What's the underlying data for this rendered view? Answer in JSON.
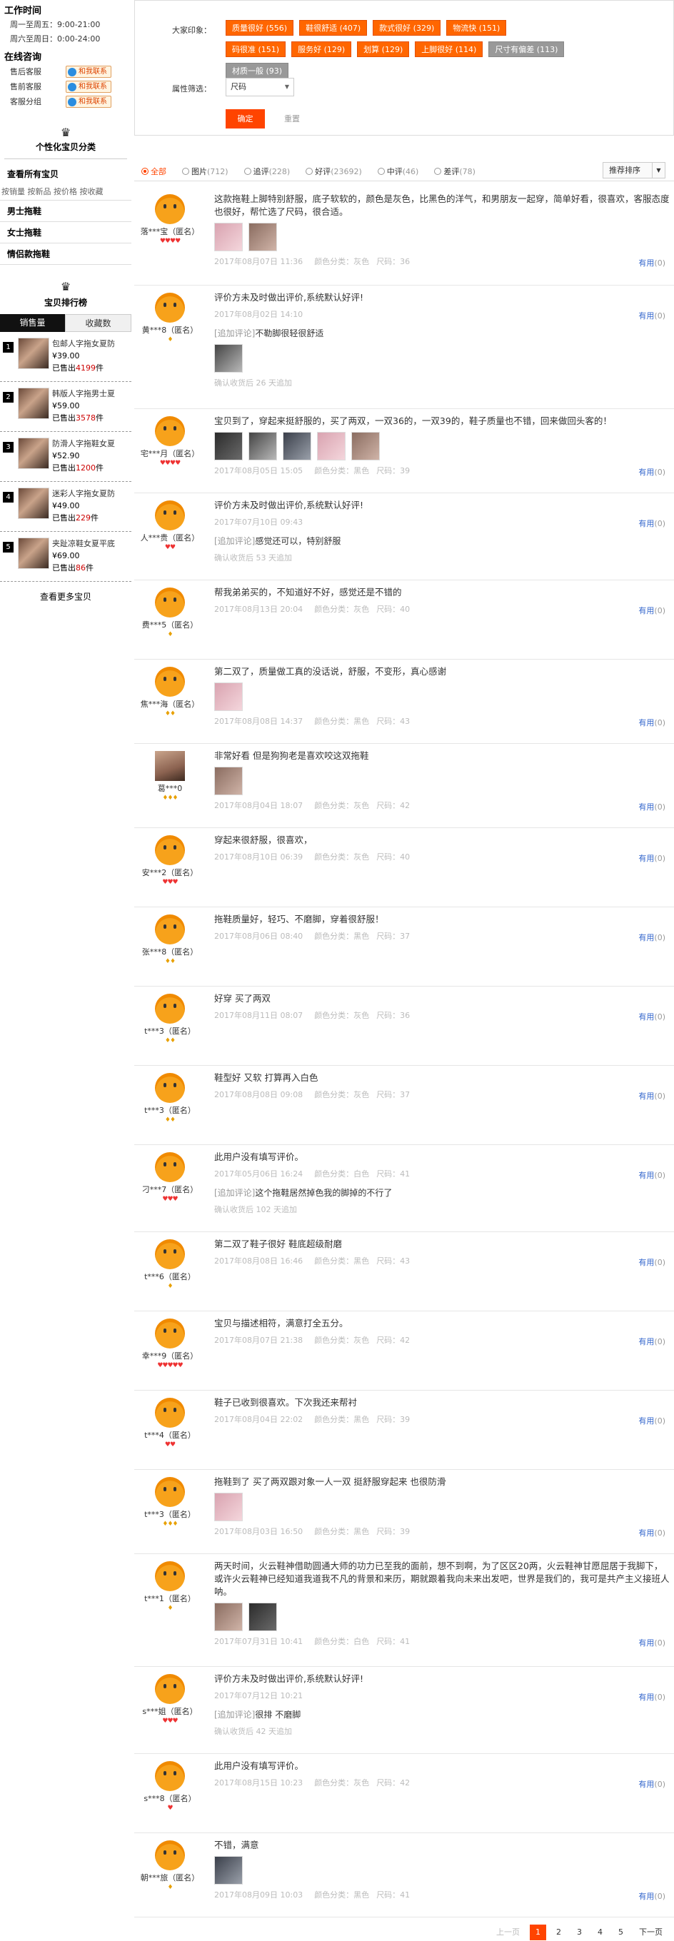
{
  "sidebar": {
    "hours_title": "工作时间",
    "hours": [
      "周一至周五：9:00-21:00",
      "周六至周日：0:00-24:00"
    ],
    "cs_title": "在线咨询",
    "cs": [
      {
        "label": "售后客服",
        "button": "和我联系"
      },
      {
        "label": "售前客服",
        "button": "和我联系"
      },
      {
        "label": "客服分组",
        "button": "和我联系"
      }
    ],
    "crown_icon": "crown-icon",
    "cat_title": "个性化宝贝分类",
    "all_goods": "查看所有宝贝",
    "sort_links": "按销量 按新品 按价格 按收藏",
    "categories": [
      "男士拖鞋",
      "女士拖鞋",
      "情侣款拖鞋"
    ],
    "rank_title": "宝贝排行榜",
    "rank_tabs": [
      "销售量",
      "收藏数"
    ],
    "rank_items": [
      {
        "num": "1",
        "name": "包邮人字拖女夏防",
        "price": "¥39.00",
        "sold_prefix": "已售出",
        "sold": "4199",
        "sold_suffix": "件"
      },
      {
        "num": "2",
        "name": "韩版人字拖男士夏",
        "price": "¥59.00",
        "sold_prefix": "已售出",
        "sold": "3578",
        "sold_suffix": "件"
      },
      {
        "num": "3",
        "name": "防滑人字拖鞋女夏",
        "price": "¥52.90",
        "sold_prefix": "已售出",
        "sold": "1200",
        "sold_suffix": "件"
      },
      {
        "num": "4",
        "name": "迷彩人字拖女夏防",
        "price": "¥49.00",
        "sold_prefix": "已售出",
        "sold": "229",
        "sold_suffix": "件"
      },
      {
        "num": "5",
        "name": "夹趾凉鞋女夏平底",
        "price": "¥69.00",
        "sold_prefix": "已售出",
        "sold": "86",
        "sold_suffix": "件"
      }
    ],
    "more": "查看更多宝贝"
  },
  "filter": {
    "impression_label": "大家印象：",
    "tags": [
      {
        "text": "质量很好 (556)",
        "neg": false
      },
      {
        "text": "鞋很舒适 (407)",
        "neg": false
      },
      {
        "text": "款式很好 (329)",
        "neg": false
      },
      {
        "text": "物流快 (151)",
        "neg": false
      },
      {
        "text": "码很准 (151)",
        "neg": false
      },
      {
        "text": "服务好 (129)",
        "neg": false
      },
      {
        "text": "划算 (129)",
        "neg": false
      },
      {
        "text": "上脚很好 (114)",
        "neg": false
      },
      {
        "text": "尺寸有偏差 (113)",
        "neg": true
      },
      {
        "text": "材质一般 (93)",
        "neg": true
      }
    ],
    "attr_label": "属性筛选：",
    "attr_value": "尺码",
    "confirm": "确定",
    "reset": "重置"
  },
  "typebar": {
    "options": [
      {
        "label": "全部",
        "count": "",
        "on": true
      },
      {
        "label": "图片",
        "count": "(712)",
        "on": false
      },
      {
        "label": "追评",
        "count": "(228)",
        "on": false
      },
      {
        "label": "好评",
        "count": "(23692)",
        "on": false
      },
      {
        "label": "中评",
        "count": "(46)",
        "on": false
      },
      {
        "label": "差评",
        "count": "(78)",
        "on": false
      }
    ],
    "sort": "推荐排序"
  },
  "reviews": [
    {
      "user": "落***宝（匿名）",
      "level": "♥♥♥♥",
      "lc": "red",
      "avatar": "default",
      "content": "这款拖鞋上脚特别舒服，底子软软的，颜色是灰色，比黑色的洋气，和男朋友一起穿，简单好看，很喜欢，客服态度也很好，帮忙选了尺码，很合适。",
      "pics": 2,
      "date": "2017年08月07日 11:36",
      "color": "颜色分类：灰色",
      "size": "尺码：36",
      "useful": "有用",
      "useful_count": "(0)"
    },
    {
      "user": "黄***8（匿名）",
      "level": "♦",
      "lc": "yel",
      "avatar": "default",
      "content": "评价方未及时做出评价,系统默认好评!",
      "pics": 0,
      "date": "2017年08月02日 14:10",
      "color": "",
      "size": "",
      "useful": "有用",
      "useful_count": "(0)",
      "append": "不勒脚很轻很舒适",
      "append_pics": 1,
      "append_meta": "确认收货后 26 天追加"
    },
    {
      "user": "宅***月（匿名）",
      "level": "♥♥♥♥",
      "lc": "red",
      "avatar": "default",
      "content": "宝贝到了，穿起来挺舒服的，买了两双，一双36的，一双39的，鞋子质量也不错，回来做回头客的！",
      "pics": 5,
      "date": "2017年08月05日 15:05",
      "color": "颜色分类：黑色",
      "size": "尺码：39",
      "useful": "有用",
      "useful_count": "(0)"
    },
    {
      "user": "人***贵（匿名）",
      "level": "♥♥",
      "lc": "red",
      "avatar": "default",
      "content": "评价方未及时做出评价,系统默认好评!",
      "pics": 0,
      "date": "2017年07月10日 09:43",
      "color": "",
      "size": "",
      "useful": "有用",
      "useful_count": "(0)",
      "append": "感觉还可以，特别舒服",
      "append_pics": 0,
      "append_meta": "确认收货后 53 天追加"
    },
    {
      "user": "费***5（匿名）",
      "level": "♦",
      "lc": "yel",
      "avatar": "default",
      "content": "帮我弟弟买的，不知道好不好，感觉还是不错的",
      "pics": 0,
      "date": "2017年08月13日 20:04",
      "color": "颜色分类：灰色",
      "size": "尺码：40",
      "useful": "有用",
      "useful_count": "(0)"
    },
    {
      "user": "焦***海（匿名）",
      "level": "♦♦",
      "lc": "yel",
      "avatar": "default",
      "content": "第二双了，质量做工真的没话说，舒服，不变形，真心感谢",
      "pics": 1,
      "date": "2017年08月08日 14:37",
      "color": "颜色分类：黑色",
      "size": "尺码：43",
      "useful": "有用",
      "useful_count": "(0)"
    },
    {
      "user": "葛***0",
      "level": "♦♦♦",
      "lc": "yel",
      "avatar": "photo",
      "content": "非常好看 但是狗狗老是喜欢咬这双拖鞋",
      "pics": 1,
      "date": "2017年08月04日 18:07",
      "color": "颜色分类：灰色",
      "size": "尺码：42",
      "useful": "有用",
      "useful_count": "(0)"
    },
    {
      "user": "安***2（匿名）",
      "level": "♥♥♥",
      "lc": "red",
      "avatar": "default",
      "content": "穿起来很舒服，很喜欢，",
      "pics": 0,
      "date": "2017年08月10日 06:39",
      "color": "颜色分类：灰色",
      "size": "尺码：40",
      "useful": "有用",
      "useful_count": "(0)"
    },
    {
      "user": "张***8（匿名）",
      "level": "♦♦",
      "lc": "yel",
      "avatar": "default",
      "content": "拖鞋质量好，轻巧、不磨脚，穿着很舒服！",
      "pics": 0,
      "date": "2017年08月06日 08:40",
      "color": "颜色分类：黑色",
      "size": "尺码：37",
      "useful": "有用",
      "useful_count": "(0)"
    },
    {
      "user": "t***3（匿名）",
      "level": "♦♦",
      "lc": "yel",
      "avatar": "default",
      "content": "好穿 买了两双",
      "pics": 0,
      "date": "2017年08月11日 08:07",
      "color": "颜色分类：灰色",
      "size": "尺码：36",
      "useful": "有用",
      "useful_count": "(0)"
    },
    {
      "user": "t***3（匿名）",
      "level": "♦♦",
      "lc": "yel",
      "avatar": "default",
      "content": "鞋型好 又软 打算再入白色",
      "pics": 0,
      "date": "2017年08月08日 09:08",
      "color": "颜色分类：灰色",
      "size": "尺码：37",
      "useful": "有用",
      "useful_count": "(0)"
    },
    {
      "user": "刁***7（匿名）",
      "level": "♥♥♥",
      "lc": "red",
      "avatar": "default",
      "content": "此用户没有填写评价。",
      "pics": 0,
      "date": "2017年05月06日 16:24",
      "color": "颜色分类：白色",
      "size": "尺码：41",
      "useful": "有用",
      "useful_count": "(0)",
      "append": "这个拖鞋居然掉色我的脚掉的不行了",
      "append_pics": 0,
      "append_meta": "确认收货后 102 天追加"
    },
    {
      "user": "t***6（匿名）",
      "level": "♦",
      "lc": "yel",
      "avatar": "default",
      "content": "第二双了鞋子很好 鞋底超级耐磨",
      "pics": 0,
      "date": "2017年08月08日 16:46",
      "color": "颜色分类：黑色",
      "size": "尺码：43",
      "useful": "有用",
      "useful_count": "(0)"
    },
    {
      "user": "幸***9（匿名）",
      "level": "♥♥♥♥♥",
      "lc": "red",
      "avatar": "default",
      "content": "宝贝与描述相符，满意打全五分。",
      "pics": 0,
      "date": "2017年08月07日 21:38",
      "color": "颜色分类：灰色",
      "size": "尺码：42",
      "useful": "有用",
      "useful_count": "(0)"
    },
    {
      "user": "t***4（匿名）",
      "level": "♥♥",
      "lc": "red",
      "avatar": "default",
      "content": "鞋子已收到很喜欢。下次我还来帮衬",
      "pics": 0,
      "date": "2017年08月04日 22:02",
      "color": "颜色分类：黑色",
      "size": "尺码：39",
      "useful": "有用",
      "useful_count": "(0)"
    },
    {
      "user": "t***3（匿名）",
      "level": "♦♦♦",
      "lc": "yel",
      "avatar": "default",
      "content": "拖鞋到了 买了两双跟对象一人一双 挺舒服穿起来 也很防滑",
      "pics": 1,
      "date": "2017年08月03日 16:50",
      "color": "颜色分类：黑色",
      "size": "尺码：39",
      "useful": "有用",
      "useful_count": "(0)"
    },
    {
      "user": "t***1（匿名）",
      "level": "♦",
      "lc": "yel",
      "avatar": "default",
      "content": "两天时间，火云鞋神借助圆通大师的功力已至我的面前，想不到啊，为了区区20两，火云鞋神甘愿屈居于我脚下，或许火云鞋神已经知道我道我不凡的背景和来历，期就跟着我向未来出发吧，世界是我们的，我可是共产主义接班人呐。",
      "pics": 2,
      "date": "2017年07月31日 10:41",
      "color": "颜色分类：白色",
      "size": "尺码：41",
      "useful": "有用",
      "useful_count": "(0)"
    },
    {
      "user": "s***姐（匿名）",
      "level": "♥♥♥",
      "lc": "red",
      "avatar": "default",
      "content": "评价方未及时做出评价,系统默认好评!",
      "pics": 0,
      "date": "2017年07月12日 10:21",
      "color": "",
      "size": "",
      "useful": "有用",
      "useful_count": "(0)",
      "append": "很排 不磨脚",
      "append_pics": 0,
      "append_meta": "确认收货后 42 天追加"
    },
    {
      "user": "s***8（匿名）",
      "level": "♥",
      "lc": "red",
      "avatar": "default",
      "content": "此用户没有填写评价。",
      "pics": 0,
      "date": "2017年08月15日 10:23",
      "color": "颜色分类：灰色",
      "size": "尺码：42",
      "useful": "有用",
      "useful_count": "(0)"
    },
    {
      "user": "朝***旅（匿名）",
      "level": "♦",
      "lc": "yel",
      "avatar": "default",
      "content": "不错，满意",
      "pics": 1,
      "date": "2017年08月09日 10:03",
      "color": "颜色分类：黑色",
      "size": "尺码：41",
      "useful": "有用",
      "useful_count": "(0)"
    }
  ],
  "pager": {
    "prev": "上一页",
    "pages": [
      "1",
      "2",
      "3",
      "4",
      "5"
    ],
    "current": "1",
    "next": "下一页"
  },
  "colors": {
    "accent": "#ff4400",
    "tag_positive": "#ff6600",
    "tag_negative": "#999999",
    "link": "#3366cc"
  }
}
